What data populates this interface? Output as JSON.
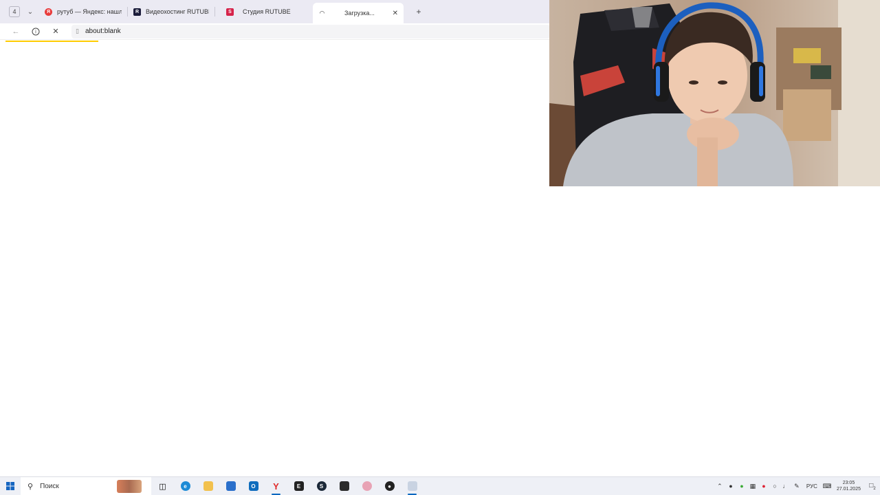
{
  "browser": {
    "tab_count": "4",
    "tabs": [
      {
        "label": "рутуб — Яндекс: нашлось",
        "favicon": "yandex-icon",
        "color": "#e83b3b"
      },
      {
        "label": "Видеохостинг RUTUBE. С",
        "favicon": "rutube-icon",
        "color": "#1b1c3a"
      },
      {
        "label": "Студия RUTUBE",
        "favicon": "rutube-studio-icon",
        "color": "#d6234a"
      },
      {
        "label": "Загрузка...",
        "favicon": "loading-spinner-icon",
        "color": "#333333",
        "active": true
      }
    ],
    "address": "about:blank",
    "loading_progress": 0.17
  },
  "taskbar": {
    "search_placeholder": "Поиск",
    "language": "РУС",
    "time": "23:05",
    "date": "27.01.2025",
    "notification_count": "2"
  },
  "colors": {
    "accent_yellow": "#ffcc00",
    "tabbar_bg": "#ebeaf3",
    "taskbar_bg": "#eef0f6",
    "windows_blue": "#0067c0"
  }
}
